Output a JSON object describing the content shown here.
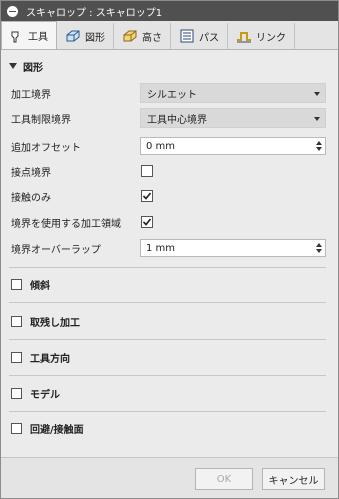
{
  "window": {
    "title": "スキャロップ : スキャロップ1"
  },
  "tabs": [
    {
      "label": "工具"
    },
    {
      "label": "図形"
    },
    {
      "label": "高さ"
    },
    {
      "label": "パス"
    },
    {
      "label": "リンク"
    }
  ],
  "section": {
    "title": "図形"
  },
  "fields": {
    "machining_boundary": {
      "label": "加工境界",
      "value": "シルエット"
    },
    "tool_containment": {
      "label": "工具制限境界",
      "value": "工具中心境界"
    },
    "additional_offset": {
      "label": "追加オフセット",
      "value": "0 mm"
    },
    "contact_boundary": {
      "label": "接点境界",
      "checked": false
    },
    "contact_only": {
      "label": "接触のみ",
      "checked": true
    },
    "boundary_region": {
      "label": "境界を使用する加工領域",
      "checked": true
    },
    "boundary_overlap": {
      "label": "境界オーバーラップ",
      "value": "1 mm"
    }
  },
  "groups": [
    {
      "label": "傾斜"
    },
    {
      "label": "取残し加工"
    },
    {
      "label": "工具方向"
    },
    {
      "label": "モデル"
    },
    {
      "label": "回避/接触面"
    }
  ],
  "footer": {
    "ok": "OK",
    "cancel": "キャンセル"
  },
  "colors": {
    "titlebar": "#505050",
    "select_bg": "#d9d9d9"
  }
}
